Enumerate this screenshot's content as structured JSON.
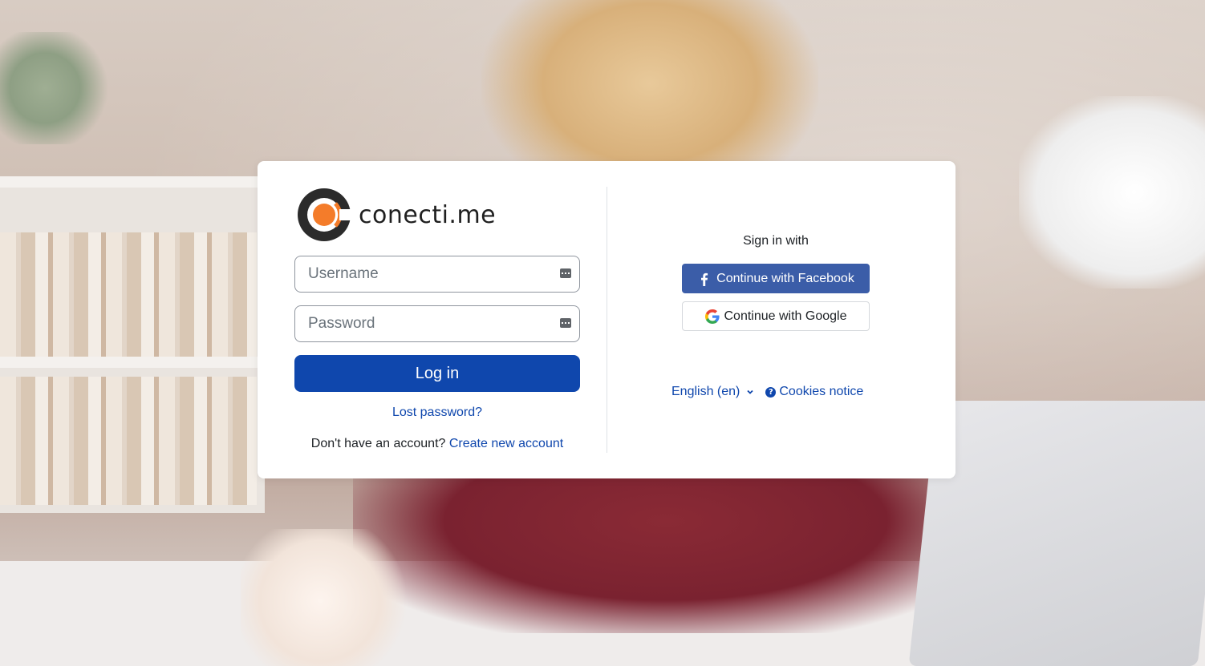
{
  "brand": {
    "name": "conecti.me",
    "accent": "#f47c2a",
    "dark": "#2b2b2b"
  },
  "login": {
    "username_placeholder": "Username",
    "password_placeholder": "Password",
    "login_button": "Log in",
    "lost_password": "Lost password?",
    "no_account_text": "Don't have an account?",
    "create_account": "Create new account",
    "primary_color": "#0f47ad"
  },
  "sso": {
    "heading": "Sign in with",
    "facebook_label": "Continue with Facebook",
    "google_label": "Continue with Google",
    "facebook_color": "#3b5da8"
  },
  "footer": {
    "language": "English (en)",
    "cookies": "Cookies notice"
  },
  "icons": [
    "logo-icon",
    "keyboard-icon",
    "facebook-icon",
    "google-icon",
    "chevron-down-icon",
    "question-circle-icon"
  ]
}
